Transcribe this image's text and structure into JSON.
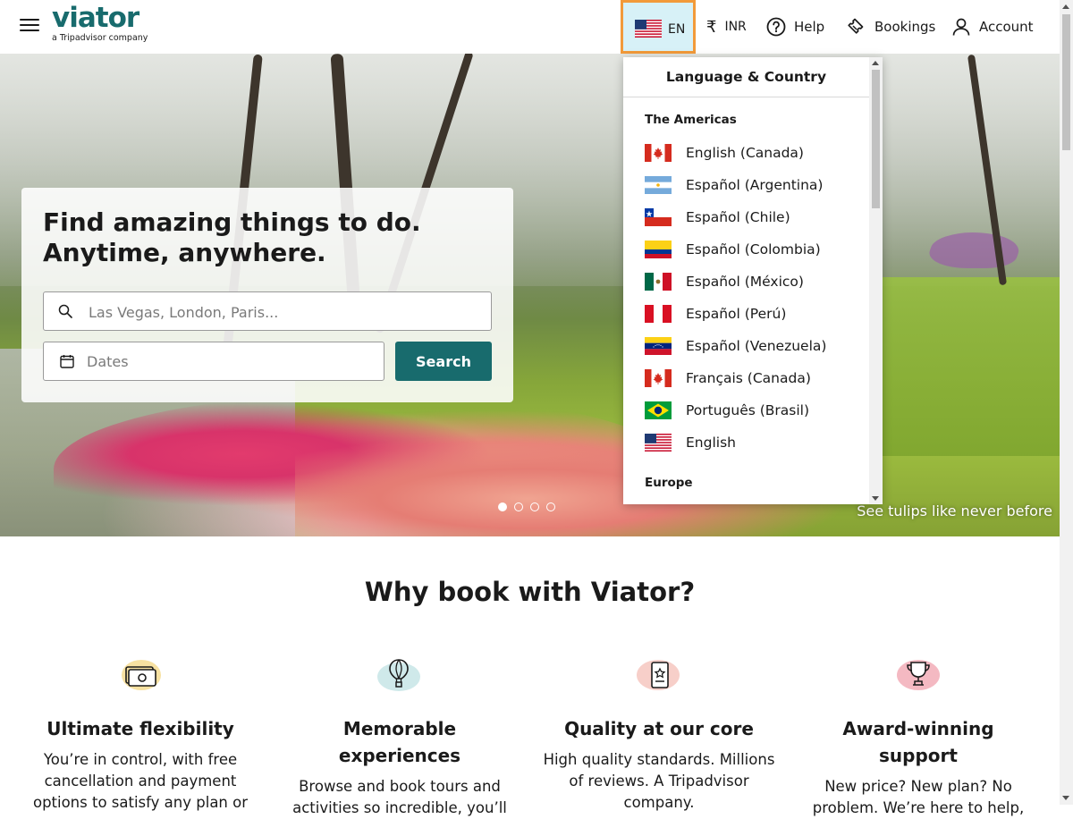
{
  "header": {
    "logo": "viator",
    "logo_sub": "a Tripadvisor company",
    "language_code": "EN",
    "currency_symbol": "₹",
    "currency": "INR",
    "help": "Help",
    "bookings": "Bookings",
    "account": "Account"
  },
  "hero": {
    "headline": "Find amazing things to do. Anytime, anywhere.",
    "search_placeholder": "Las Vegas, London, Paris...",
    "dates_label": "Dates",
    "search_button": "Search",
    "caption": "See tulips like never before",
    "slide_count": 4,
    "active_slide": 1
  },
  "language_menu": {
    "title": "Language & Country",
    "sections": [
      {
        "name": "The Americas",
        "items": [
          {
            "label": "English (Canada)",
            "flag": "ca"
          },
          {
            "label": "Español (Argentina)",
            "flag": "ar"
          },
          {
            "label": "Español (Chile)",
            "flag": "cl"
          },
          {
            "label": "Español (Colombia)",
            "flag": "co"
          },
          {
            "label": "Español (México)",
            "flag": "mx"
          },
          {
            "label": "Español (Perú)",
            "flag": "pe"
          },
          {
            "label": "Español (Venezuela)",
            "flag": "ve"
          },
          {
            "label": "Français (Canada)",
            "flag": "ca"
          },
          {
            "label": "Português (Brasil)",
            "flag": "br"
          },
          {
            "label": "English",
            "flag": "us"
          }
        ]
      },
      {
        "name": "Europe",
        "items": []
      }
    ]
  },
  "why": {
    "title": "Why book with Viator?",
    "features": [
      {
        "title": "Ultimate flexibility",
        "text": "You’re in control, with free cancellation and payment options to satisfy any plan or",
        "icon": "money-icon",
        "icon_bg": "#f7e1a1"
      },
      {
        "title": "Memorable experiences",
        "text": "Browse and book tours and activities so incredible, you’ll",
        "icon": "balloon-icon",
        "icon_bg": "#cfe9ea"
      },
      {
        "title": "Quality at our core",
        "text": "High quality standards. Millions of reviews. A Tripadvisor company.",
        "icon": "quality-badge-icon",
        "icon_bg": "#f7cfc9"
      },
      {
        "title": "Award-winning support",
        "text": "New price? New plan? No problem. We’re here to help,",
        "icon": "trophy-icon",
        "icon_bg": "#f4b9c2"
      }
    ]
  },
  "colors": {
    "brand": "#186b6d",
    "lang_highlight_border": "#f29a3a",
    "lang_highlight_bg": "#d7f1f7"
  }
}
